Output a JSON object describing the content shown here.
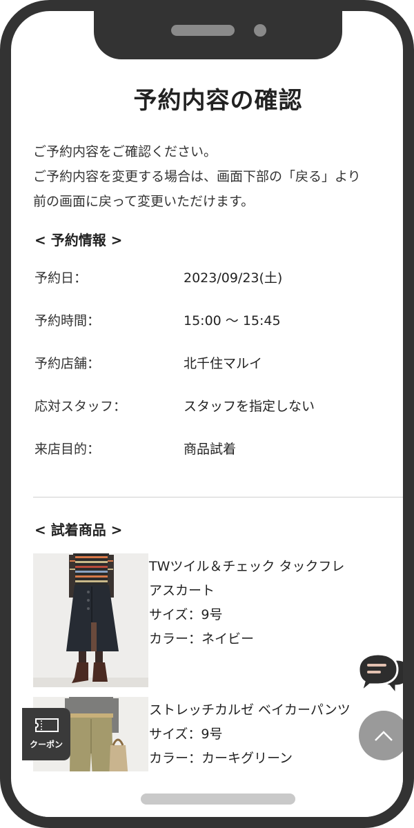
{
  "page": {
    "title": "予約内容の確認",
    "intro_line1": "ご予約内容をご確認ください。",
    "intro_line2": "ご予約内容を変更する場合は、画面下部の「戻る」より",
    "intro_line3": "前の画面に戻って変更いただけます。"
  },
  "reservation": {
    "heading": "< 予約情報 >",
    "rows": [
      {
        "label": "予約日：",
        "value": "2023/09/23(土)"
      },
      {
        "label": "予約時間：",
        "value": "15:00 〜 15:45"
      },
      {
        "label": "予約店舗：",
        "value": "北千住マルイ"
      },
      {
        "label": "応対スタッフ：",
        "value": "スタッフを指定しない"
      },
      {
        "label": "来店目的：",
        "value": "商品試着"
      }
    ]
  },
  "products": {
    "heading": "< 試着商品 >",
    "items": [
      {
        "name_line1": "TWツイル＆チェック タックフレ",
        "name_line2": "アスカート",
        "size": "サイズ：9号",
        "color": "カラー：ネイビー"
      },
      {
        "name_line1": "ストレッチカルゼ ベイカーパンツ",
        "size": "サイズ：9号",
        "color": "カラー：カーキグリーン"
      }
    ]
  },
  "floating": {
    "coupon_label": "クーポン"
  },
  "icons": {
    "chat": "chat-bubbles-icon",
    "scroll_top": "chevron-up-icon",
    "coupon": "ticket-icon"
  },
  "colors": {
    "frame": "#333333",
    "scroll_top_bg": "#9a9a9a",
    "coupon_bg": "#3a3a3a"
  }
}
